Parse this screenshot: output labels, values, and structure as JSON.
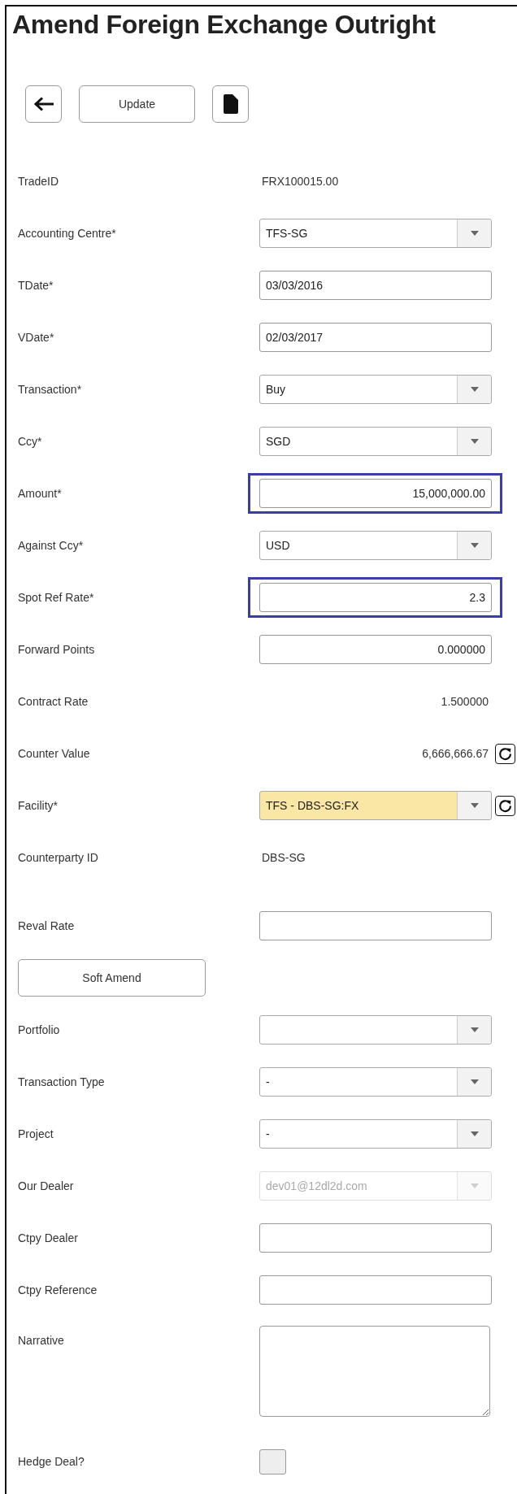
{
  "title": "Amend Foreign Exchange Outright",
  "toolbar": [
    {
      "kind": "back"
    },
    {
      "kind": "text",
      "label": "Update"
    },
    {
      "kind": "document"
    }
  ],
  "sections": [
    {
      "fields": [
        {
          "kind": "value",
          "label": "TradeID",
          "value": "FRX100015.00",
          "right_aligned": false,
          "refresh": false
        },
        {
          "kind": "select",
          "label": "Accounting Centre*",
          "value": "TFS-SG",
          "disabled": false,
          "flagged": false,
          "refresh": false
        },
        {
          "kind": "input",
          "label": "TDate*",
          "value": "03/03/2016",
          "right_aligned": false,
          "highlighted": false
        },
        {
          "kind": "input",
          "label": "VDate*",
          "value": "02/03/2017",
          "right_aligned": false,
          "highlighted": false
        },
        {
          "kind": "select",
          "label": "Transaction*",
          "value": "Buy",
          "disabled": false,
          "flagged": false,
          "refresh": false
        },
        {
          "kind": "select",
          "label": "Ccy*",
          "value": "SGD",
          "disabled": false,
          "flagged": false,
          "refresh": false
        },
        {
          "kind": "input",
          "label": "Amount*",
          "value": "15,000,000.00",
          "right_aligned": true,
          "highlighted": true
        },
        {
          "kind": "select",
          "label": "Against Ccy*",
          "value": "USD",
          "disabled": false,
          "flagged": false,
          "refresh": false
        },
        {
          "kind": "input",
          "label": "Spot Ref Rate*",
          "value": "2.3",
          "right_aligned": true,
          "highlighted": true
        },
        {
          "kind": "input",
          "label": "Forward Points",
          "value": "0.000000",
          "right_aligned": true,
          "highlighted": false
        },
        {
          "kind": "value",
          "label": "Contract Rate",
          "value": "1.500000",
          "right_aligned": true,
          "refresh": false
        },
        {
          "kind": "value",
          "label": "Counter Value",
          "value": "6,666,666.67",
          "right_aligned": true,
          "refresh": true
        },
        {
          "kind": "select",
          "label": "Facility*",
          "value": "TFS - DBS-SG:FX",
          "disabled": false,
          "flagged": true,
          "refresh": true
        },
        {
          "kind": "value",
          "label": "Counterparty ID",
          "value": "DBS-SG",
          "right_aligned": false,
          "refresh": false
        }
      ]
    },
    {
      "fields": [
        {
          "kind": "input",
          "label": "Reval Rate",
          "highlighted": false
        },
        {
          "kind": "button",
          "label": "Soft Amend"
        },
        {
          "kind": "select",
          "label": "Portfolio",
          "disabled": false,
          "flagged": false,
          "refresh": false
        },
        {
          "kind": "select",
          "label": "Transaction Type",
          "value": "-",
          "disabled": false,
          "flagged": false,
          "refresh": false
        },
        {
          "kind": "select",
          "label": "Project",
          "value": "-",
          "disabled": false,
          "flagged": false,
          "refresh": false
        },
        {
          "kind": "select",
          "label": "Our Dealer",
          "value": "dev01@12dl2d.com",
          "disabled": true,
          "flagged": false,
          "refresh": false
        },
        {
          "kind": "input",
          "label": "Ctpy Dealer",
          "highlighted": false
        },
        {
          "kind": "input",
          "label": "Ctpy Reference",
          "highlighted": false
        },
        {
          "kind": "textarea",
          "label": "Narrative"
        },
        {
          "kind": "checkbox",
          "label": "Hedge Deal?",
          "checked": false
        }
      ]
    }
  ]
}
